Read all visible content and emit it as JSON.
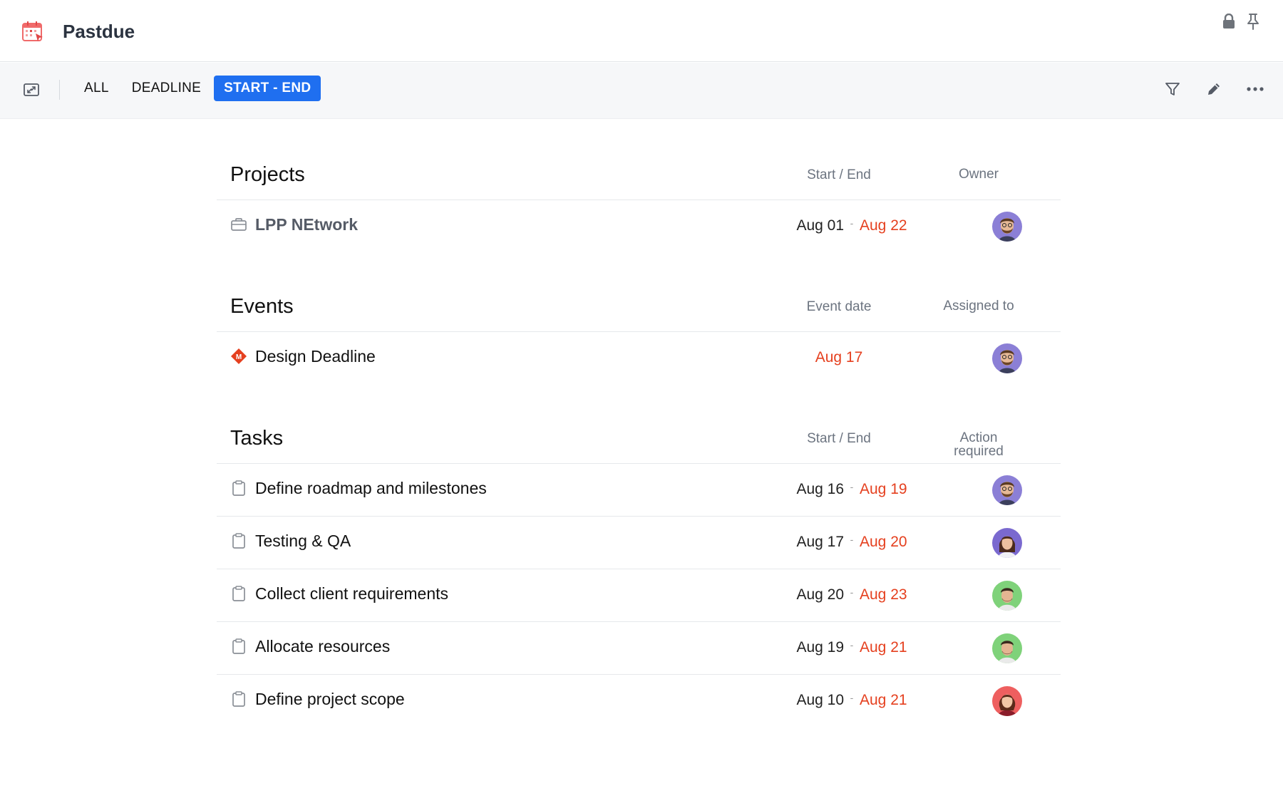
{
  "app": {
    "title": "Pastdue"
  },
  "toolbar": {
    "tabs": [
      {
        "label": "ALL",
        "active": false
      },
      {
        "label": "DEADLINE",
        "active": false
      },
      {
        "label": "START - END",
        "active": true
      }
    ]
  },
  "projects": {
    "title": "Projects",
    "col1": "Start / End",
    "col2": "Owner",
    "rows": [
      {
        "name": "LPP NEtwork",
        "start": "Aug 01",
        "end": "Aug 22",
        "avatar": "avatar-purple"
      }
    ]
  },
  "events": {
    "title": "Events",
    "col1": "Event date",
    "col2": "Assigned to",
    "rows": [
      {
        "name": "Design Deadline",
        "date": "Aug 17",
        "badge": "M",
        "avatar": "avatar-purple"
      }
    ]
  },
  "tasks": {
    "title": "Tasks",
    "col1": "Start / End",
    "col2": "Action required",
    "rows": [
      {
        "name": "Define roadmap and milestones",
        "start": "Aug 16",
        "end": "Aug 19",
        "avatar": "avatar-purple"
      },
      {
        "name": "Testing & QA",
        "start": "Aug 17",
        "end": "Aug 20",
        "avatar": "avatar-violet"
      },
      {
        "name": "Collect client requirements",
        "start": "Aug 20",
        "end": "Aug 23",
        "avatar": "avatar-green"
      },
      {
        "name": "Allocate resources",
        "start": "Aug 19",
        "end": "Aug 21",
        "avatar": "avatar-green"
      },
      {
        "name": "Define project scope",
        "start": "Aug 10",
        "end": "Aug 21",
        "avatar": "avatar-red"
      }
    ]
  },
  "colors": {
    "accent": "#1f6ff0",
    "overdue": "#e5401f",
    "muted": "#6c7480"
  }
}
